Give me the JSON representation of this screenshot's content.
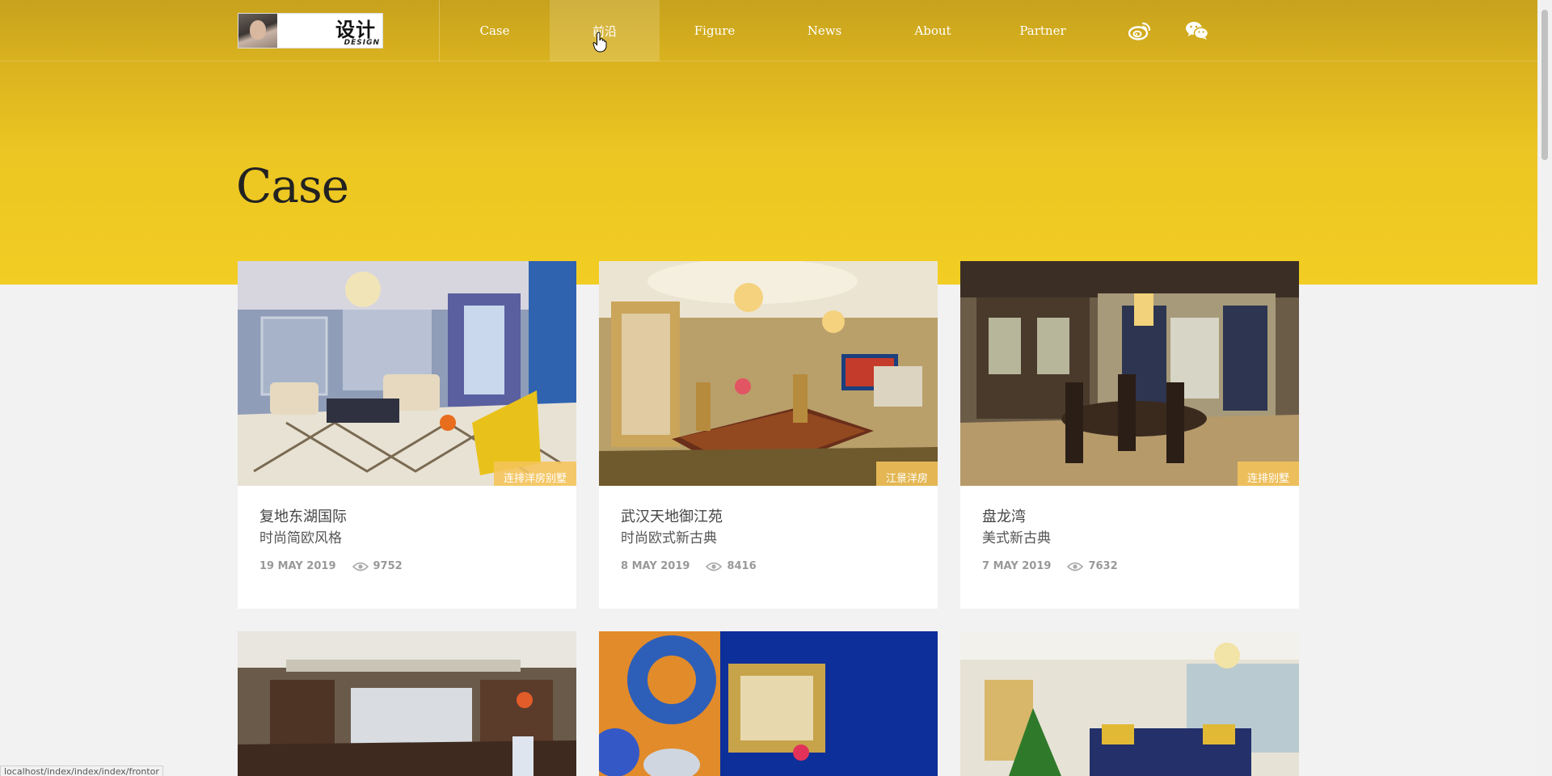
{
  "logo": {
    "text": "设计",
    "sub": "DESIGN"
  },
  "nav": {
    "items": [
      {
        "label": "Case"
      },
      {
        "label": "前沿"
      },
      {
        "label": "Figure"
      },
      {
        "label": "News"
      },
      {
        "label": "About"
      },
      {
        "label": "Partner"
      }
    ],
    "active_index": 1,
    "icons": [
      "weibo-icon",
      "wechat-icon"
    ]
  },
  "page": {
    "title": "Case"
  },
  "cards": [
    {
      "tag": "连排洋房别墅",
      "title": "复地东湖国际",
      "style": "时尚简欧风格",
      "date": "19 MAY 2019",
      "views": "9752"
    },
    {
      "tag": "江景洋房",
      "title": "武汉天地御江苑",
      "style": "时尚欧式新古典",
      "date": "8 MAY 2019",
      "views": "8416"
    },
    {
      "tag": "连排别墅",
      "title": "盘龙湾",
      "style": "美式新古典",
      "date": "7 MAY 2019",
      "views": "7632"
    }
  ],
  "status_bar": {
    "url": "localhost/index/index/index/frontor"
  },
  "colors": {
    "header_gold": "#d9b21f",
    "hero_yellow": "#f2cd23",
    "tag_bg": "#f5c45a"
  }
}
